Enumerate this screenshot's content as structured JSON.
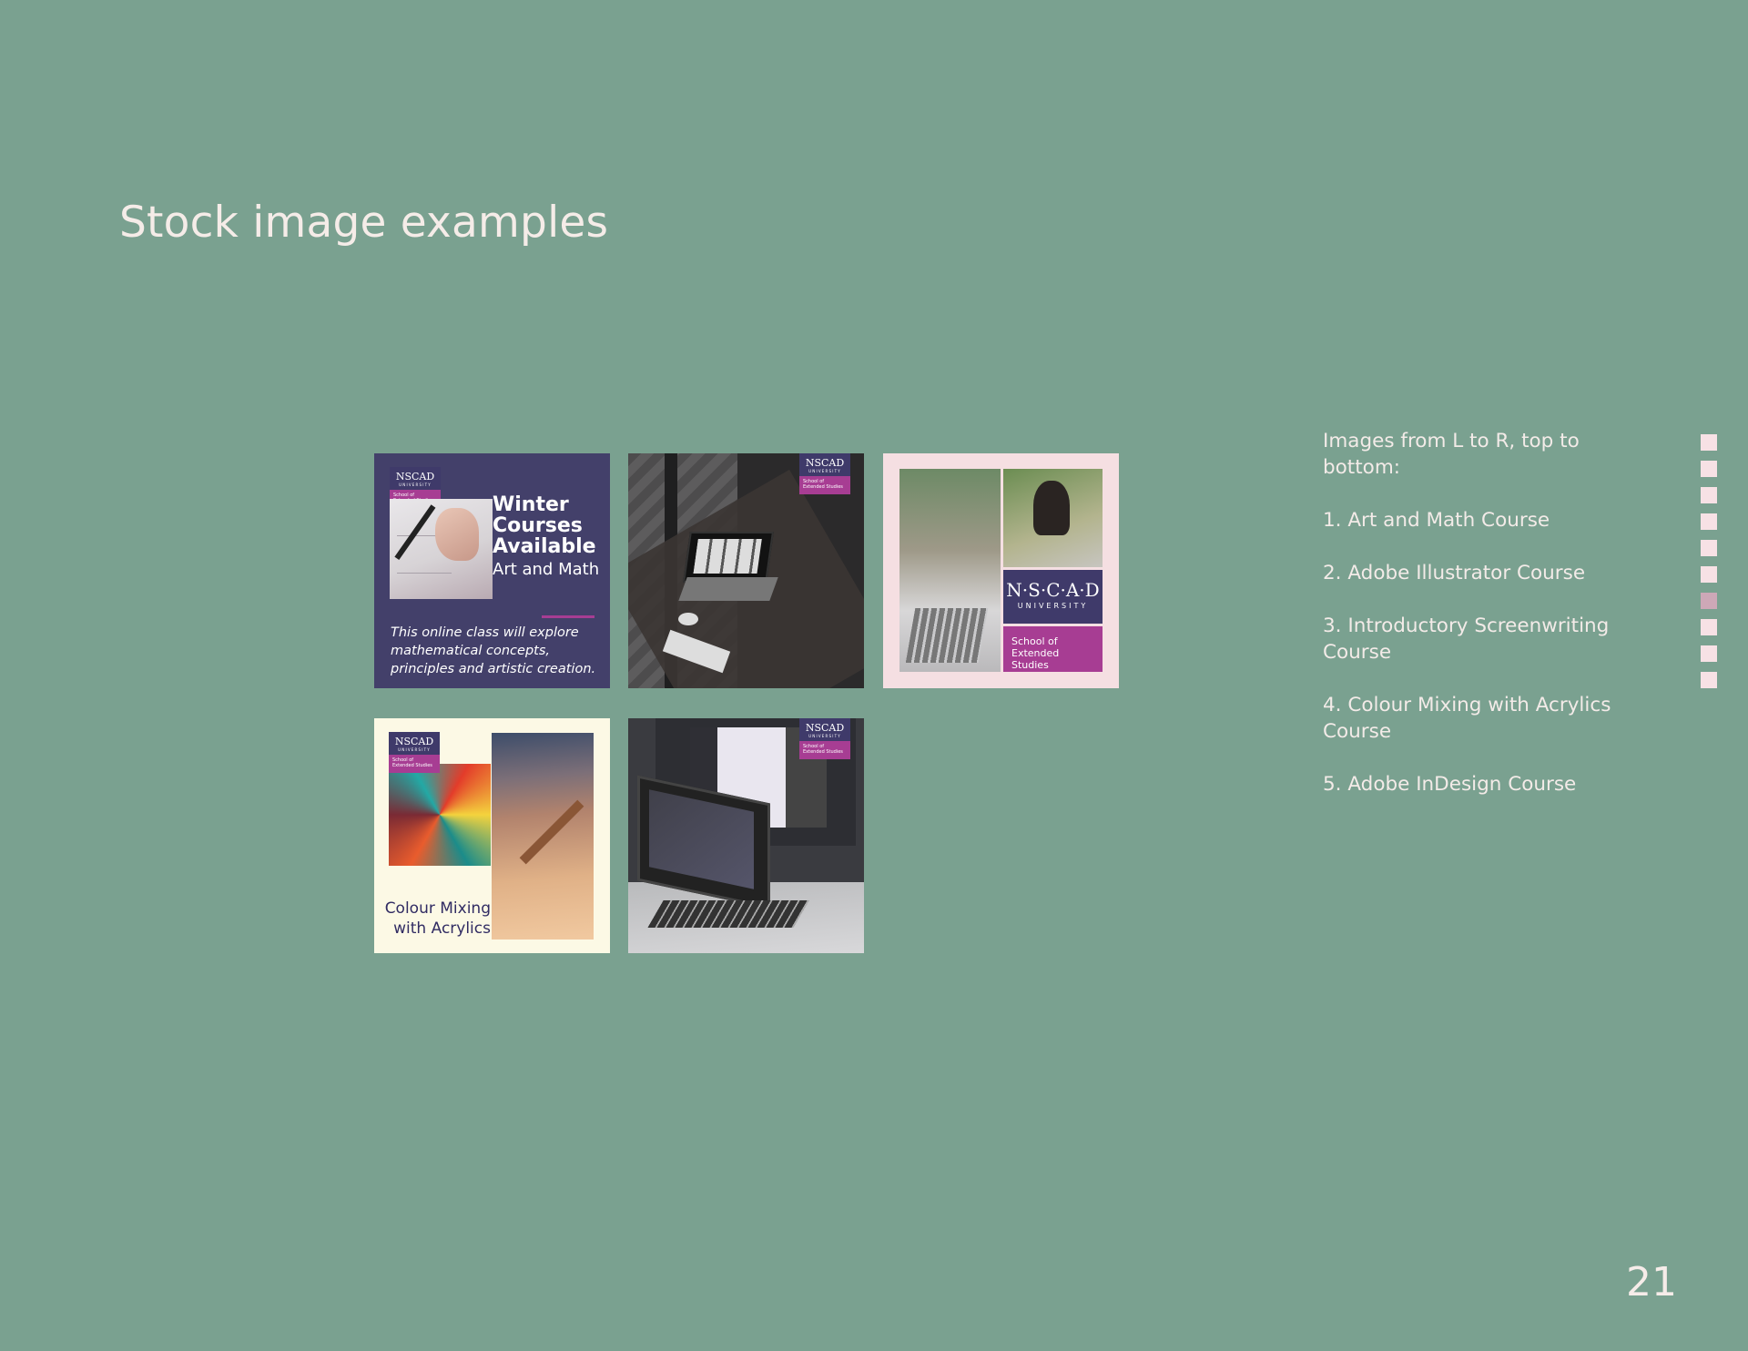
{
  "title": "Stock image examples",
  "tiles": [
    {
      "badge_name": "NSCAD",
      "badge_sub": "UNIVERSITY",
      "badge_school": "School of Extended Studies",
      "headline": "Winter Courses Available",
      "subhead": "Art and Math",
      "description": "This online class will explore mathematical concepts, principles and artistic creation."
    },
    {
      "badge_name": "NSCAD",
      "badge_sub": "UNIVERSITY",
      "badge_school": "School of Extended Studies"
    },
    {
      "panel_name": "N·S·C·A·D",
      "panel_sub": "UNIVERSITY",
      "panel_school": "School of Extended Studies"
    },
    {
      "badge_name": "NSCAD",
      "badge_sub": "UNIVERSITY",
      "badge_school": "School of Extended Studies",
      "caption": "Colour Mixing with Acrylics"
    },
    {
      "badge_name": "NSCAD",
      "badge_sub": "UNIVERSITY",
      "badge_school": "School of Extended Studies"
    }
  ],
  "sidebar": {
    "intro": "Images from L to R, top to bottom:",
    "items": [
      "1. Art and Math Course",
      "2. Adobe Illustrator Course",
      "3. Introductory Screenwriting Course",
      "4. Colour Mixing with Acrylics Course",
      "5. Adobe InDesign Course"
    ]
  },
  "page_nav": {
    "total": 10,
    "active_index": 6
  },
  "page_number": "21",
  "colors": {
    "background": "#7aa190",
    "brand_purple": "#3f3a6a",
    "brand_magenta": "#a73d93",
    "nav_dot": "#f7e1e5",
    "nav_dot_active": "#cda8b7"
  }
}
